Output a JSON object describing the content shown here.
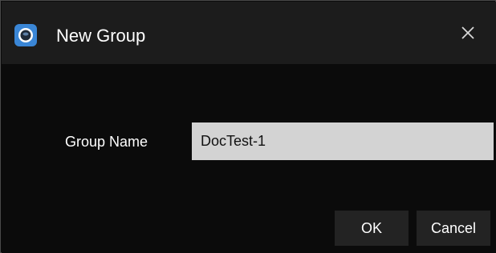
{
  "dialog": {
    "title": "New Group",
    "app_icon": "camera-lens-icon",
    "close_icon": "close-icon"
  },
  "form": {
    "group_name_label": "Group Name",
    "group_name_value": "DocTest-1"
  },
  "buttons": {
    "ok_label": "OK",
    "cancel_label": "Cancel"
  },
  "colors": {
    "background": "#0b0b0b",
    "titlebar": "#1c1c1c",
    "input_background": "#d3d3d3",
    "button_background": "#232323",
    "accent": "#3a86d6",
    "text": "#ffffff"
  }
}
